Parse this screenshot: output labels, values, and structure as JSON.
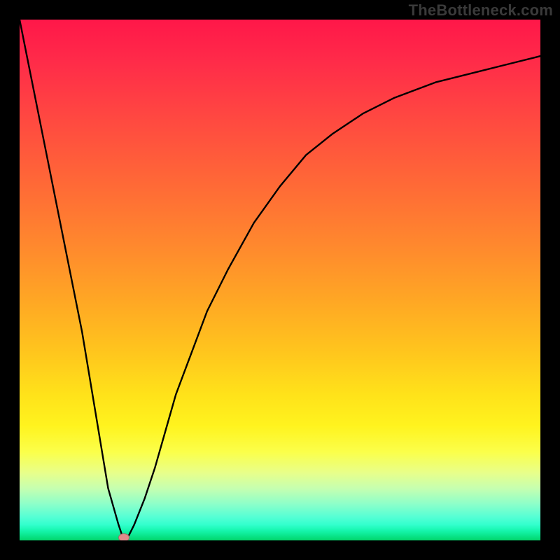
{
  "watermark": "TheBottleneck.com",
  "chart_data": {
    "type": "line",
    "title": "",
    "xlabel": "",
    "ylabel": "",
    "xlim": [
      0,
      100
    ],
    "ylim": [
      0,
      100
    ],
    "grid": false,
    "legend": false,
    "series": [
      {
        "name": "bottleneck-curve",
        "x": [
          0,
          4,
          8,
          12,
          15,
          17,
          19,
          20,
          21,
          22,
          24,
          26,
          28,
          30,
          33,
          36,
          40,
          45,
          50,
          55,
          60,
          66,
          72,
          80,
          88,
          94,
          100
        ],
        "y": [
          100,
          80,
          60,
          40,
          22,
          10,
          3,
          0,
          1,
          3,
          8,
          14,
          21,
          28,
          36,
          44,
          52,
          61,
          68,
          74,
          78,
          82,
          85,
          88,
          90,
          91.5,
          93
        ]
      }
    ],
    "marker": {
      "x": 20,
      "y": 0.5,
      "color": "#df8c8b"
    },
    "background_gradient": {
      "top": "#ff1749",
      "mid": "#ffd11a",
      "bottom": "#02d56b"
    }
  }
}
